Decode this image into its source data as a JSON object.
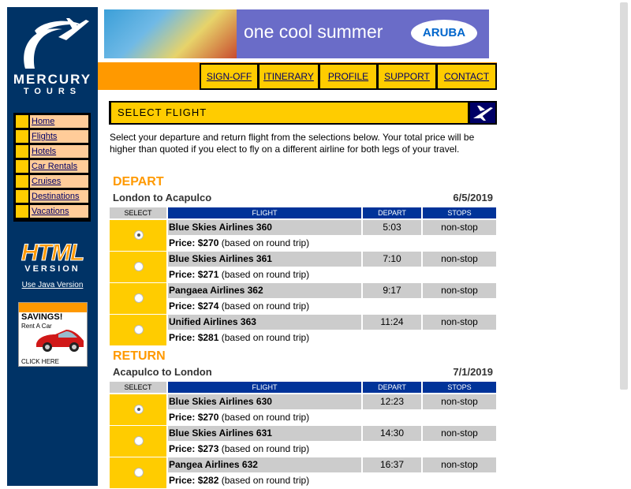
{
  "sidebar": {
    "brand_top": "MERCURY",
    "brand_bottom": "TOURS",
    "nav": [
      {
        "label": "Home"
      },
      {
        "label": "Flights"
      },
      {
        "label": "Hotels"
      },
      {
        "label": "Car Rentals"
      },
      {
        "label": "Cruises"
      },
      {
        "label": "Destinations"
      },
      {
        "label": "Vacations"
      }
    ],
    "html_version_big": "HTML",
    "html_version_sub": "VERSION",
    "java_link": "Use Java Version",
    "ad": {
      "savings": "SAVINGS!",
      "rent": "Rent A Car",
      "click": "CLICK HERE"
    }
  },
  "banner": {
    "tagline": "one cool summer",
    "logo": "ARUBA"
  },
  "menu": [
    "SIGN-OFF",
    "ITINERARY",
    "PROFILE",
    "SUPPORT",
    "CONTACT"
  ],
  "header": {
    "title": "SELECT FLIGHT",
    "icon": "plane-icon"
  },
  "intro": "Select your departure and return flight from the selections below. Your total price will be higher than quoted if you elect to fly on a different airline for both legs of your travel.",
  "table_headers": {
    "select": "SELECT",
    "flight": "FLIGHT",
    "depart": "DEPART",
    "stops": "STOPS"
  },
  "depart": {
    "title": "DEPART",
    "route": "London to Acapulco",
    "date": "6/5/2019",
    "flights": [
      {
        "airline": "Blue Skies Airlines 360",
        "time": "5:03",
        "stops": "non-stop",
        "price": "$270",
        "note": "(based on round trip)",
        "selected": true
      },
      {
        "airline": "Blue Skies Airlines 361",
        "time": "7:10",
        "stops": "non-stop",
        "price": "$271",
        "note": "(based on round trip)",
        "selected": false
      },
      {
        "airline": "Pangaea Airlines 362",
        "time": "9:17",
        "stops": "non-stop",
        "price": "$274",
        "note": "(based on round trip)",
        "selected": false
      },
      {
        "airline": "Unified Airlines 363",
        "time": "11:24",
        "stops": "non-stop",
        "price": "$281",
        "note": "(based on round trip)",
        "selected": false
      }
    ]
  },
  "return": {
    "title": "RETURN",
    "route": "Acapulco to London",
    "date": "7/1/2019",
    "flights": [
      {
        "airline": "Blue Skies Airlines 630",
        "time": "12:23",
        "stops": "non-stop",
        "price": "$270",
        "note": "(based on round trip)",
        "selected": true
      },
      {
        "airline": "Blue Skies Airlines 631",
        "time": "14:30",
        "stops": "non-stop",
        "price": "$273",
        "note": "(based on round trip)",
        "selected": false
      },
      {
        "airline": "Pangea Airlines 632",
        "time": "16:37",
        "stops": "non-stop",
        "price": "$282",
        "note": "(based on round trip)",
        "selected": false
      }
    ]
  },
  "price_label": "Price:",
  "colors": {
    "navy": "#003366",
    "orange": "#FF9900",
    "yellow": "#FFCC00",
    "header_blue": "#003399"
  }
}
